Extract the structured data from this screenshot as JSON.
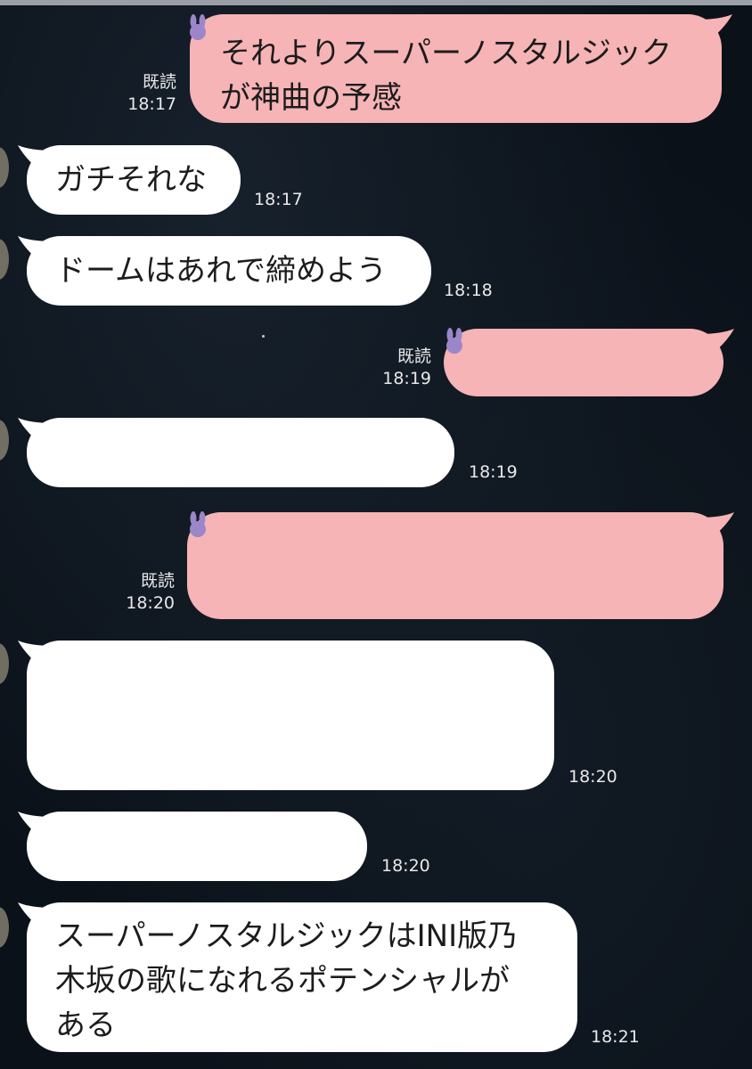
{
  "chat": {
    "messages": [
      {
        "side": "sent",
        "text": "それよりスーパーノスタルジック\nが神曲の予感",
        "read": "既読",
        "time": "18:17"
      },
      {
        "side": "received",
        "text": "ガチそれな",
        "time": "18:17"
      },
      {
        "side": "received",
        "text": "ドームはあれで締めよう",
        "time": "18:18"
      },
      {
        "side": "sent",
        "text": "",
        "read": "既読",
        "time": "18:19"
      },
      {
        "side": "received",
        "text": "",
        "time": "18:19"
      },
      {
        "side": "sent",
        "text": "",
        "read": "既読",
        "time": "18:20"
      },
      {
        "side": "received",
        "text": "",
        "time": "18:20"
      },
      {
        "side": "received",
        "text": "",
        "time": "18:20"
      },
      {
        "side": "received",
        "text": "スーパーノスタルジックはINI版乃\n木坂の歌になれるポテンシャルが\nある",
        "time": "18:21"
      }
    ]
  },
  "colors": {
    "background": "#0b1119",
    "sent_bubble": "#f6b4b6",
    "received_bubble": "#ffffff",
    "meta_text": "#e8e8e8",
    "sticker_icon": "#9b86c9"
  },
  "icons": {
    "sent_sticker": "bunny-icon"
  }
}
